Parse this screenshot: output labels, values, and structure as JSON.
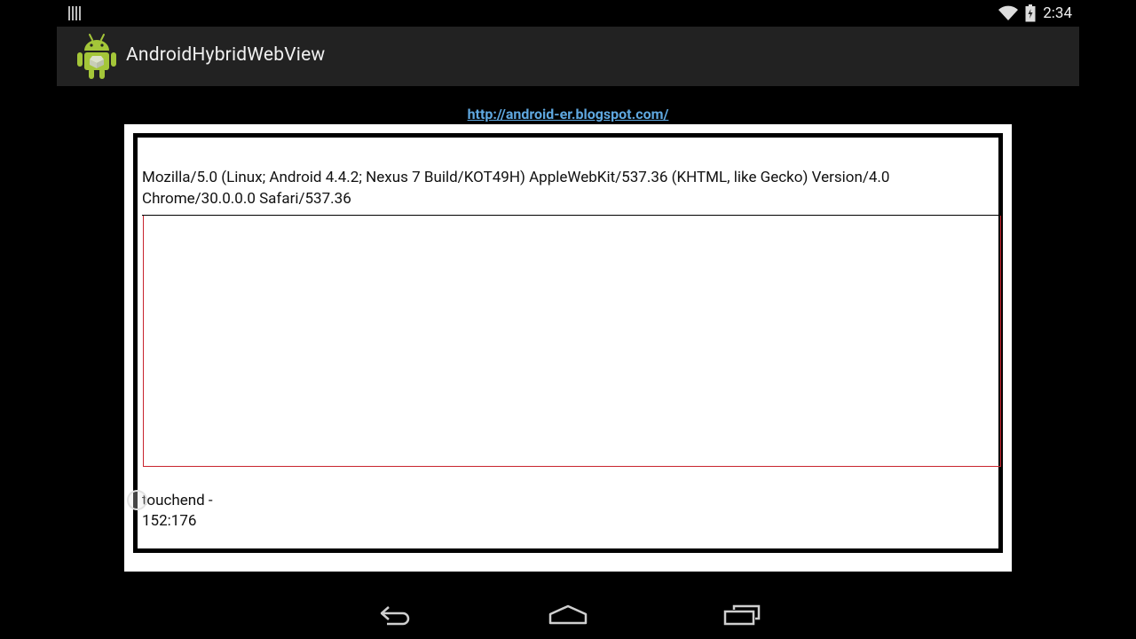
{
  "status_bar": {
    "time": "2:34",
    "icons": [
      "notification-icon",
      "wifi-icon",
      "battery-icon"
    ]
  },
  "action_bar": {
    "app_icon": "android-robot-icon",
    "title": "AndroidHybridWebView"
  },
  "web_content": {
    "link_text": "http://android-er.blogspot.com/",
    "user_agent": "Mozilla/5.0 (Linux; Android 4.4.2; Nexus 7 Build/KOT49H) AppleWebKit/537.36 (KHTML, like Gecko) Version/4.0 Chrome/30.0.0.0 Safari/537.36",
    "event_line1": "touchend -",
    "event_line2": "152:176"
  },
  "nav_bar": {
    "buttons": [
      "back-icon",
      "home-icon",
      "recents-icon"
    ]
  },
  "colors": {
    "background": "#000000",
    "action_bar": "#222222",
    "link": "#5fa8e0",
    "touch_border": "#c8242e",
    "android_green": "#a4c639"
  }
}
